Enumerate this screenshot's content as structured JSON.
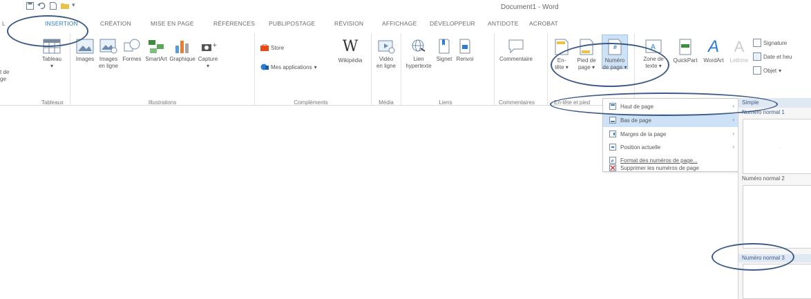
{
  "window": {
    "title": "Document1 - Word"
  },
  "tabs": {
    "fichier_partial": "L",
    "insertion": "INSERTION",
    "creation": "CRÉATION",
    "mise_en_page": "MISE EN PAGE",
    "references": "RÉFÉRENCES",
    "publipostage": "PUBLIPOSTAGE",
    "revision": "RÉVISION",
    "affichage": "AFFICHAGE",
    "developpeur": "DÉVELOPPEUR",
    "antidote": "ANTIDOTE",
    "acrobat": "ACROBAT"
  },
  "ribbon": {
    "partial_left": {
      "line1": "t de",
      "line2": "ge"
    },
    "tableau": "Tableau",
    "tableaux_group": "Tableaux",
    "images": "Images",
    "images_en_ligne_1": "Images",
    "images_en_ligne_2": "en ligne",
    "formes": "Formes",
    "smartart": "SmartArt",
    "graphique": "Graphique",
    "capture": "Capture",
    "illustrations_group": "Illustrations",
    "store": "Store",
    "mes_applications": "Mes applications",
    "wikipedia": "Wikipédia",
    "complements_group": "Compléments",
    "video_1": "Vidéo",
    "video_2": "en ligne",
    "media_group": "Média",
    "lien_1": "Lien",
    "lien_2": "hypertexte",
    "signet": "Signet",
    "renvoi": "Renvoi",
    "liens_group": "Liens",
    "commentaire": "Commentaire",
    "commentaires_group": "Commentaires",
    "en_tete_1": "En-",
    "en_tete_2": "tête",
    "pied_1": "Pied de",
    "pied_2": "page",
    "numero_1": "Numéro",
    "numero_2": "de page",
    "en_tete_group": "En-tête et pied",
    "zone_1": "Zone de",
    "zone_2": "texte",
    "quickpart": "QuickPart",
    "wordart": "WordArt",
    "lettrine": "Lettrine",
    "signature": "Signature",
    "date_heure": "Date et heu",
    "objet": "Objet"
  },
  "menu": {
    "items": [
      {
        "label": "Haut de page",
        "has_submenu": true
      },
      {
        "label": "Bas de page",
        "has_submenu": true
      },
      {
        "label": "Marges de la page",
        "has_submenu": true
      },
      {
        "label": "Position actuelle",
        "has_submenu": true
      },
      {
        "label": "Format des numéros de page...",
        "has_submenu": false
      },
      {
        "label": "Supprimer les numéros de page",
        "has_submenu": false
      }
    ]
  },
  "gallery": {
    "header": "Simple",
    "item1": "Numéro normal 1",
    "item2": "Numéro normal 2",
    "item3": "Numéro normal 3"
  },
  "colors": {
    "accent": "#2b7cd3",
    "circle": "#3c5a87",
    "menu_highlight": "#cde1f7"
  }
}
